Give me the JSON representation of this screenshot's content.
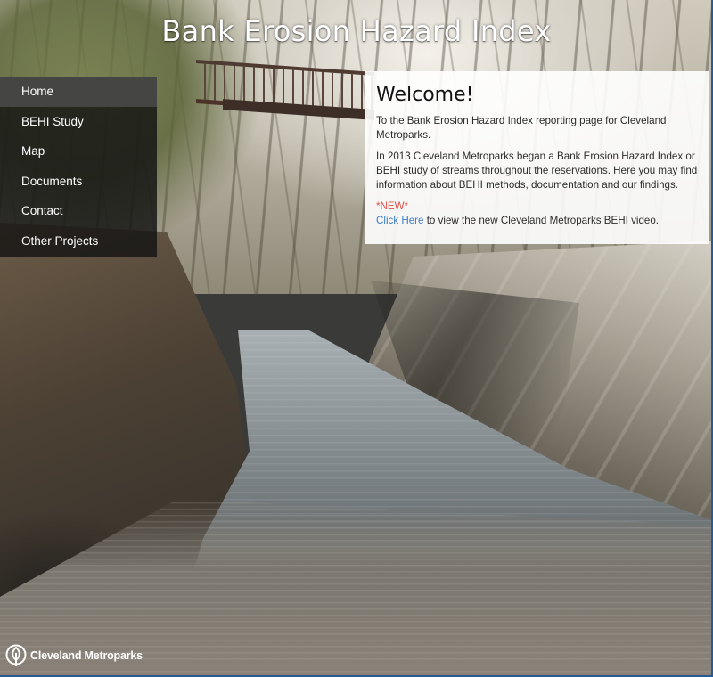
{
  "site": {
    "title": "Bank Erosion Hazard Index"
  },
  "nav": {
    "items": [
      {
        "label": "Home",
        "active": true
      },
      {
        "label": "BEHI Study",
        "active": false
      },
      {
        "label": "Map",
        "active": false
      },
      {
        "label": "Documents",
        "active": false
      },
      {
        "label": "Contact",
        "active": false
      },
      {
        "label": "Other Projects",
        "active": false
      }
    ]
  },
  "welcome": {
    "heading": "Welcome!",
    "intro": "To the Bank Erosion Hazard Index reporting page for Cleveland Metroparks.",
    "body": "In 2013 Cleveland Metroparks began a Bank Erosion Hazard Index or BEHI study of streams throughout the reservations. Here you may find information about BEHI methods, documentation and our findings.",
    "new_tag": "*NEW*",
    "video_link": "Click Here",
    "video_text": " to view the new Cleveland Metroparks BEHI video."
  },
  "footer": {
    "logo_text": "Cleveland Metroparks",
    "logo_icon": "metroparks-tree-logo-icon"
  },
  "colors": {
    "nav_bg": "#141414",
    "nav_active": "#4b4b4b",
    "link": "#3b7cc4",
    "new_tag": "#e0514a",
    "frame": "#2a5a94"
  }
}
